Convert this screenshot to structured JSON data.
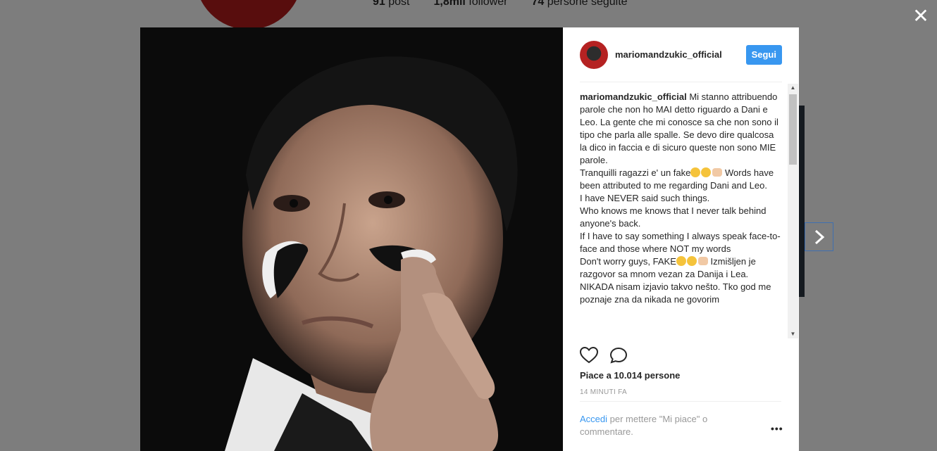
{
  "background": {
    "stats": [
      {
        "count": "91",
        "label": "post"
      },
      {
        "count": "1,8mil",
        "label": "follower"
      },
      {
        "count": "74",
        "label": "persone seguite"
      }
    ]
  },
  "post": {
    "username": "mariomandzukic_official",
    "follow_label": "Segui",
    "caption_lines": [
      "Mi stanno attribuendo parole che non ho MAI detto riguardo a Dani e Leo. La gente che mi conosce sa che non sono il tipo che parla alle spalle. Se devo dire qualcosa la dico in faccia e di sicuro queste non sono MIE parole.",
      "Tranquilli ragazzi e' un fake",
      "Words have been attributed to me regarding Dani and Leo.",
      "I have NEVER said such things.",
      "Who knows me knows that I never talk behind anyone's back.",
      "If I have to say something I always speak face-to-face and those where NOT my words",
      "Don't worry guys, FAKE",
      "Izmišljen je razgovor sa mnom vezan za Danija i Lea.",
      "NIKADA nisam izjavio takvo nešto. Tko god me poznaje zna da nikada ne govorim"
    ],
    "likes": "Piace a 10.014 persone",
    "time": "14 MINUTI FA",
    "login_link": "Accedi",
    "login_text": " per mettere \"Mi piace\" o commentare.",
    "more_label": "•••"
  },
  "icons": {
    "close": "close-icon",
    "next": "chevron-right-icon",
    "like": "heart-icon",
    "comment": "comment-bubble-icon"
  },
  "colors": {
    "accent": "#3897f0",
    "text": "#262626",
    "muted": "#999999"
  }
}
